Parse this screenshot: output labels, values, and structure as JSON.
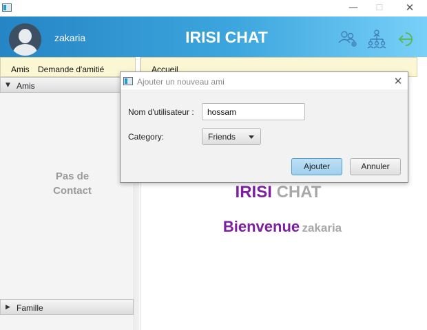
{
  "window": {
    "minimize_glyph": "—",
    "maximize_glyph": "☐",
    "close_glyph": "✕"
  },
  "header": {
    "username": "zakaria",
    "app_title": "IRISI CHAT",
    "icons": [
      "users-icon",
      "network-icon",
      "logout-icon"
    ]
  },
  "sidebar": {
    "tabs": [
      "Amis",
      "Demande d'amitié"
    ],
    "sections": [
      {
        "label": "Amis",
        "arrow": "▼"
      },
      {
        "label": "Famille",
        "arrow": "▶"
      }
    ],
    "empty_message": "Pas de Contact"
  },
  "main": {
    "tab_label": "Accueil",
    "brand_part1": "IRISI",
    "brand_part2": "CHAT",
    "welcome_part1": "Bienvenue",
    "welcome_part2": "zakaria"
  },
  "dialog": {
    "title": "Ajouter un nouveau ami",
    "close_glyph": "✕",
    "username_label": "Nom d'utilisateur :",
    "username_value": "hossam",
    "category_label": "Category:",
    "category_value": "Friends",
    "ok_label": "Ajouter",
    "cancel_label": "Annuler"
  },
  "colors": {
    "header_gradient_start": "#2585c5",
    "header_gradient_end": "#78d0f8",
    "brand_purple": "#7c1fa3",
    "muted_gray": "#a8a8a8",
    "tab_bar_bg": "#fbf7d4",
    "logout_green": "#5cb85c"
  }
}
